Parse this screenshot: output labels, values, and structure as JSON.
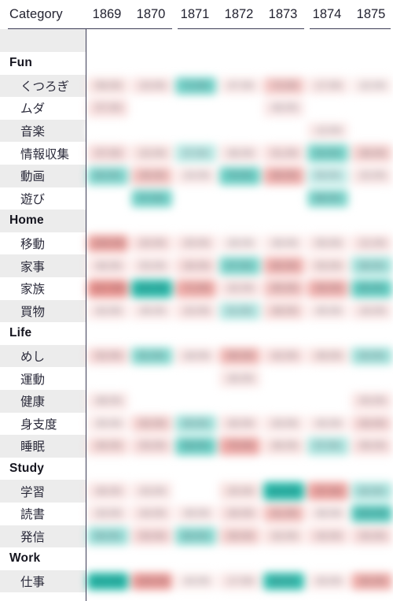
{
  "header": {
    "category_label": "Category",
    "years": [
      "1869",
      "1870",
      "1871",
      "1872",
      "1873",
      "1874",
      "1875"
    ]
  },
  "colors": {
    "positive_strong": "#14b5a3",
    "positive_mid": "#6fcfc4",
    "positive_light": "#cdece8",
    "positive_faint": "#e9f6f4",
    "negative_strong": "#ea8580",
    "negative_mid": "#f2aaa5",
    "negative_light": "#fbd9d6",
    "negative_faint": "#fdeeec",
    "neutral": "#ffffff",
    "band": "#ececec",
    "rule": "#3c3c55",
    "text": "#222230"
  },
  "chart_data": {
    "type": "heatmap",
    "title": "",
    "xlabel": "",
    "ylabel": "Category",
    "categories": [
      "1869",
      "1870",
      "1871",
      "1872",
      "1873",
      "1874",
      "1875"
    ],
    "legend": "",
    "grid": false,
    "rows": [
      {
        "label": "",
        "kind": "spacer",
        "values": [
          null,
          null,
          null,
          null,
          null,
          null,
          null
        ]
      },
      {
        "label": "Fun",
        "kind": "group",
        "values": [
          null,
          null,
          null,
          null,
          null,
          null,
          null
        ]
      },
      {
        "label": "くつろぎ",
        "kind": "item",
        "values": [
          -0.18,
          -0.16,
          0.55,
          -0.12,
          -0.38,
          -0.14,
          -0.1
        ]
      },
      {
        "label": "ムダ",
        "kind": "item",
        "values": [
          -0.2,
          0,
          0,
          0,
          -0.13,
          0,
          0
        ]
      },
      {
        "label": "音楽",
        "kind": "item",
        "values": [
          0,
          0,
          0,
          0,
          0,
          -0.12,
          0
        ]
      },
      {
        "label": "情報収集",
        "kind": "item",
        "values": [
          -0.22,
          -0.18,
          0.24,
          -0.14,
          -0.2,
          0.52,
          -0.3
        ]
      },
      {
        "label": "動画",
        "kind": "item",
        "values": [
          0.48,
          -0.42,
          -0.12,
          0.58,
          -0.6,
          0.2,
          -0.14
        ]
      },
      {
        "label": "遊び",
        "kind": "item",
        "values": [
          0,
          0.55,
          0,
          0,
          0,
          0.5,
          0
        ]
      },
      {
        "label": "Home",
        "kind": "group",
        "values": [
          null,
          null,
          null,
          null,
          null,
          null,
          null
        ]
      },
      {
        "label": "移動",
        "kind": "item",
        "values": [
          -0.72,
          -0.2,
          -0.16,
          -0.1,
          -0.12,
          -0.14,
          -0.16
        ]
      },
      {
        "label": "家事",
        "kind": "item",
        "values": [
          -0.16,
          -0.14,
          -0.22,
          0.5,
          -0.56,
          -0.18,
          0.34
        ]
      },
      {
        "label": "家族",
        "kind": "item",
        "values": [
          -0.88,
          0.92,
          -0.64,
          -0.16,
          -0.4,
          -0.58,
          0.62
        ]
      },
      {
        "label": "買物",
        "kind": "item",
        "values": [
          -0.14,
          -0.12,
          -0.16,
          0.26,
          -0.24,
          -0.12,
          -0.14
        ]
      },
      {
        "label": "Life",
        "kind": "group",
        "values": [
          null,
          null,
          null,
          null,
          null,
          null,
          null
        ]
      },
      {
        "label": "めし",
        "kind": "item",
        "values": [
          -0.26,
          0.46,
          -0.14,
          -0.52,
          -0.2,
          -0.18,
          0.34
        ]
      },
      {
        "label": "運動",
        "kind": "item",
        "values": [
          0,
          0,
          0,
          -0.14,
          0,
          0,
          0
        ]
      },
      {
        "label": "健康",
        "kind": "item",
        "values": [
          -0.14,
          0,
          0,
          0,
          0,
          0,
          -0.16
        ]
      },
      {
        "label": "身支度",
        "kind": "item",
        "values": [
          -0.12,
          -0.3,
          0.34,
          -0.16,
          -0.14,
          -0.12,
          -0.26
        ]
      },
      {
        "label": "睡眠",
        "kind": "item",
        "values": [
          -0.24,
          -0.22,
          0.58,
          -0.66,
          -0.18,
          0.3,
          -0.2
        ]
      },
      {
        "label": "Study",
        "kind": "group",
        "values": [
          null,
          null,
          null,
          null,
          null,
          null,
          null
        ]
      },
      {
        "label": "学習",
        "kind": "item",
        "values": [
          -0.16,
          -0.14,
          0,
          -0.18,
          0.94,
          -0.72,
          0.3
        ]
      },
      {
        "label": "読書",
        "kind": "item",
        "values": [
          -0.14,
          -0.16,
          -0.12,
          -0.2,
          -0.46,
          -0.12,
          0.7
        ]
      },
      {
        "label": "発信",
        "kind": "item",
        "values": [
          0.38,
          -0.26,
          0.44,
          -0.3,
          -0.18,
          -0.2,
          -0.22
        ]
      },
      {
        "label": "Work",
        "kind": "group",
        "values": [
          null,
          null,
          null,
          null,
          null,
          null,
          null
        ]
      },
      {
        "label": "仕事",
        "kind": "item",
        "values": [
          0.96,
          -0.78,
          -0.1,
          -0.14,
          0.86,
          -0.12,
          -0.62
        ]
      }
    ]
  }
}
